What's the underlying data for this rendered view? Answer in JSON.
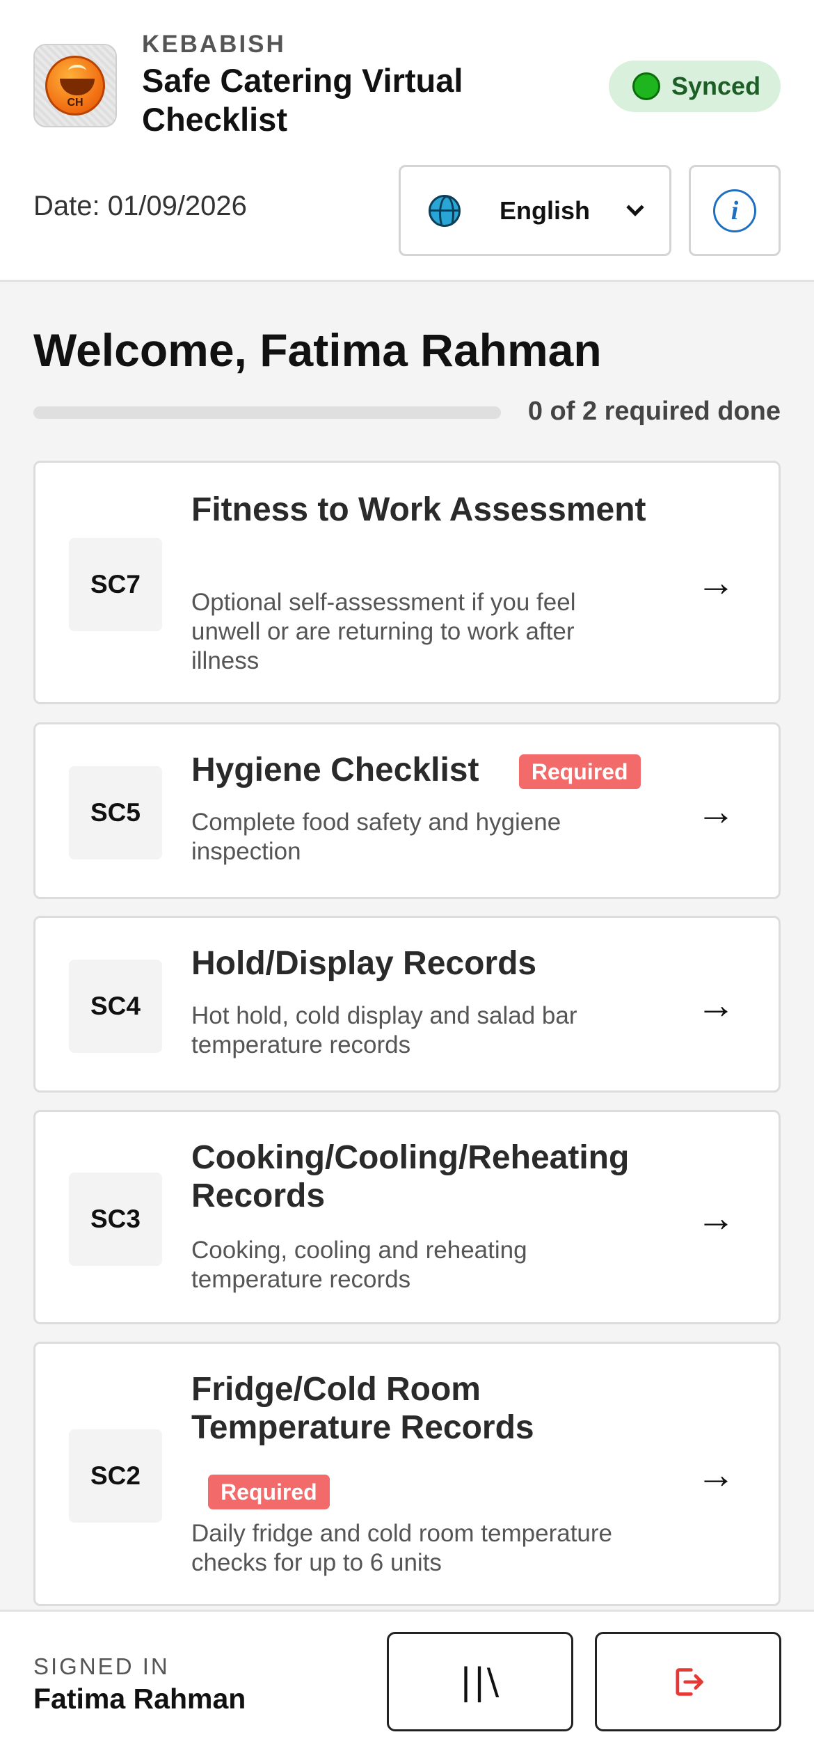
{
  "header": {
    "brand": "KEBABISH",
    "title": "Safe Catering Virtual Checklist",
    "logo_text": "CH",
    "sync_status": "Synced",
    "date": "Date: 01/09/2026",
    "language": "English",
    "info_glyph": "i"
  },
  "welcome": {
    "heading": "Welcome, Fatima Rahman",
    "progress_done": 0,
    "progress_required": 2,
    "progress_label": "0 of 2 required done"
  },
  "cards": [
    {
      "code": "SC7",
      "title": "Fitness to Work Assessment",
      "description": "Optional self-assessment if you feel unwell or are returning to work after illness",
      "badge": ""
    },
    {
      "code": "SC5",
      "title": "Hygiene Checklist",
      "description": "Complete food safety and hygiene inspection",
      "badge": "Required"
    },
    {
      "code": "SC4",
      "title": "Hold/Display Records",
      "description": "Hot hold, cold display and salad bar temperature records",
      "badge": ""
    },
    {
      "code": "SC3",
      "title": "Cooking/Cooling/Reheating Records",
      "description": "Cooking, cooling and reheating temperature records",
      "badge": ""
    },
    {
      "code": "SC2",
      "title": "Fridge/Cold Room Temperature Records",
      "description": "Daily fridge and cold room temperature checks for up to 6 units",
      "badge": "Required"
    }
  ],
  "arrow_glyph": "→",
  "footer": {
    "signed_in_label": "SIGNED IN",
    "user_name": "Fatima Rahman",
    "library_glyph": "||\\"
  },
  "colors": {
    "synced_bg": "#d8f0dc",
    "synced_dot": "#1fb51f",
    "required_badge": "#f26a6a",
    "info_blue": "#1f6fc1",
    "logout_red": "#e53935"
  }
}
